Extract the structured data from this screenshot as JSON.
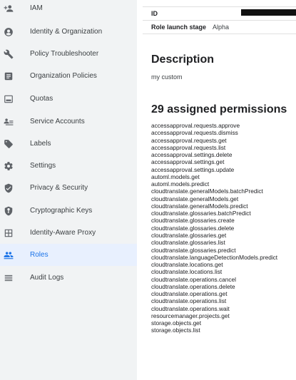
{
  "sidebar": {
    "items": [
      {
        "label": "IAM",
        "icon": "person-add-icon"
      },
      {
        "label": "Identity & Organization",
        "icon": "account-circle-icon"
      },
      {
        "label": "Policy Troubleshooter",
        "icon": "wrench-icon"
      },
      {
        "label": "Organization Policies",
        "icon": "document-list-icon"
      },
      {
        "label": "Quotas",
        "icon": "quota-monitor-icon"
      },
      {
        "label": "Service Accounts",
        "icon": "service-account-icon"
      },
      {
        "label": "Labels",
        "icon": "label-tag-icon"
      },
      {
        "label": "Settings",
        "icon": "gear-icon"
      },
      {
        "label": "Privacy & Security",
        "icon": "shield-icon"
      },
      {
        "label": "Cryptographic Keys",
        "icon": "key-shield-icon"
      },
      {
        "label": "Identity-Aware Proxy",
        "icon": "proxy-grid-icon"
      },
      {
        "label": "Roles",
        "icon": "roles-people-icon",
        "selected": true
      },
      {
        "label": "Audit Logs",
        "icon": "list-lines-icon"
      }
    ]
  },
  "details": {
    "id_label": "ID",
    "stage_label": "Role launch stage",
    "stage_value": "Alpha"
  },
  "description": {
    "heading": "Description",
    "text": "my custom"
  },
  "permissions": {
    "heading": "29 assigned permissions",
    "items": [
      "accessapproval.requests.approve",
      "accessapproval.requests.dismiss",
      "accessapproval.requests.get",
      "accessapproval.requests.list",
      "accessapproval.settings.delete",
      "accessapproval.settings.get",
      "accessapproval.settings.update",
      "automl.models.get",
      "automl.models.predict",
      "cloudtranslate.generalModels.batchPredict",
      "cloudtranslate.generalModels.get",
      "cloudtranslate.generalModels.predict",
      "cloudtranslate.glossaries.batchPredict",
      "cloudtranslate.glossaries.create",
      "cloudtranslate.glossaries.delete",
      "cloudtranslate.glossaries.get",
      "cloudtranslate.glossaries.list",
      "cloudtranslate.glossaries.predict",
      "cloudtranslate.languageDetectionModels.predict",
      "cloudtranslate.locations.get",
      "cloudtranslate.locations.list",
      "cloudtranslate.operations.cancel",
      "cloudtranslate.operations.delete",
      "cloudtranslate.operations.get",
      "cloudtranslate.operations.list",
      "cloudtranslate.operations.wait",
      "resourcemanager.projects.get",
      "storage.objects.get",
      "storage.objects.list"
    ]
  },
  "colors": {
    "sidebar_bg": "#f1f3f4",
    "selected_bg": "#e8f0fe",
    "accent": "#1a73e8",
    "icon_gray": "#5f6368"
  }
}
